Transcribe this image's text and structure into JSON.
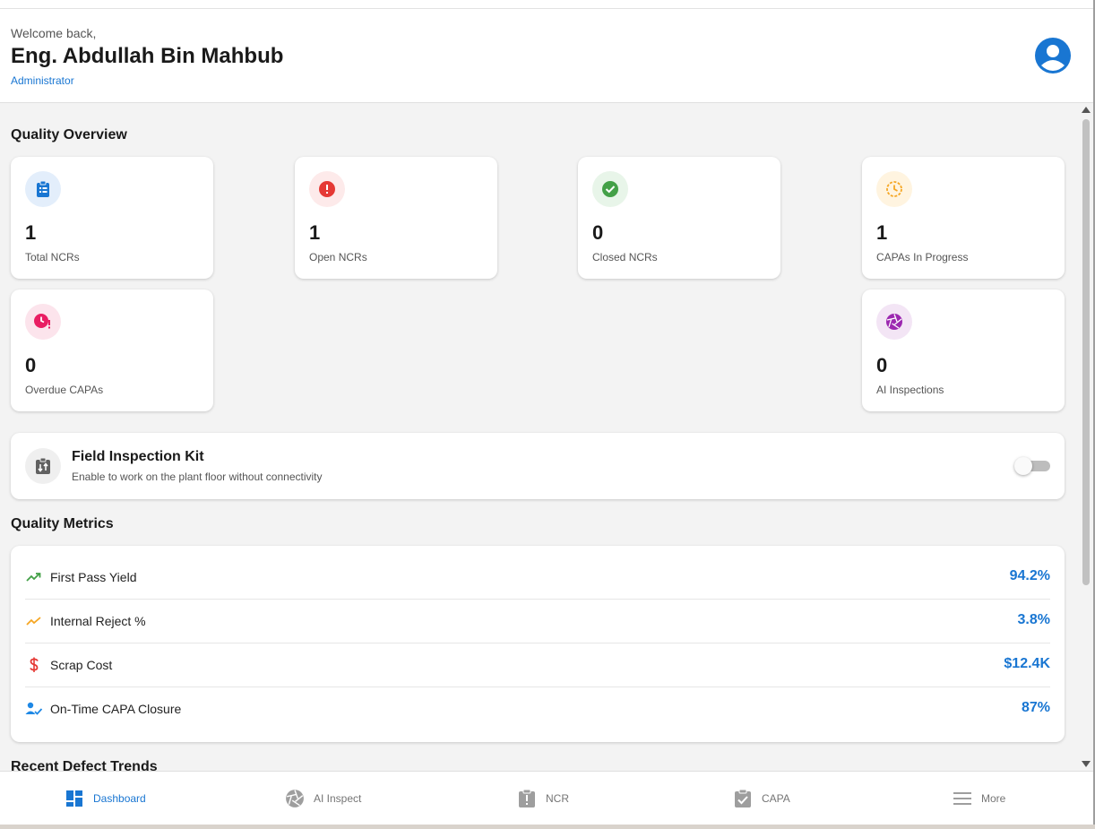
{
  "header": {
    "welcome": "Welcome back,",
    "username": "Eng. Abdullah Bin Mahbub",
    "role": "Administrator"
  },
  "quality_overview": {
    "title": "Quality Overview",
    "cards": [
      {
        "value": "1",
        "label": "Total NCRs",
        "icon": "clipboard-list-icon",
        "color": "#1976d2",
        "bg": "#e3eefb"
      },
      {
        "value": "1",
        "label": "Open NCRs",
        "icon": "alert-circle-icon",
        "color": "#e53935",
        "bg": "#fdeaea"
      },
      {
        "value": "0",
        "label": "Closed NCRs",
        "icon": "check-circle-icon",
        "color": "#43a047",
        "bg": "#e8f5e9"
      },
      {
        "value": "1",
        "label": "CAPAs In Progress",
        "icon": "clock-progress-icon",
        "color": "#f5a623",
        "bg": "#fff4e0"
      },
      {
        "value": "0",
        "label": "Overdue CAPAs",
        "icon": "clock-alert-icon",
        "color": "#e91e63",
        "bg": "#fce4ec"
      },
      {
        "value": "0",
        "label": "AI Inspections",
        "icon": "aperture-icon",
        "color": "#9c27b0",
        "bg": "#f3e5f5"
      }
    ]
  },
  "field_kit": {
    "title": "Field Inspection Kit",
    "subtitle": "Enable to work on the plant floor without connectivity",
    "enabled": false
  },
  "quality_metrics": {
    "title": "Quality Metrics",
    "rows": [
      {
        "label": "First Pass Yield",
        "value": "94.2%",
        "icon": "trending-up-icon",
        "color": "#43a047"
      },
      {
        "label": "Internal Reject %",
        "value": "3.8%",
        "icon": "trending-up-icon",
        "color": "#f5a623"
      },
      {
        "label": "Scrap Cost",
        "value": "$12.4K",
        "icon": "dollar-icon",
        "color": "#e53935"
      },
      {
        "label": "On-Time CAPA Closure",
        "value": "87%",
        "icon": "user-check-icon",
        "color": "#1e88e5"
      }
    ]
  },
  "recent_trends": {
    "title": "Recent Defect Trends"
  },
  "bottom_nav": {
    "items": [
      {
        "label": "Dashboard",
        "icon": "dashboard-icon",
        "active": true
      },
      {
        "label": "AI Inspect",
        "icon": "aperture-icon",
        "active": false
      },
      {
        "label": "NCR",
        "icon": "report-alert-icon",
        "active": false
      },
      {
        "label": "CAPA",
        "icon": "clipboard-check-icon",
        "active": false
      },
      {
        "label": "More",
        "icon": "menu-icon",
        "active": false
      }
    ]
  },
  "colors": {
    "accent": "#1976d2",
    "background": "#f3f3f3"
  }
}
